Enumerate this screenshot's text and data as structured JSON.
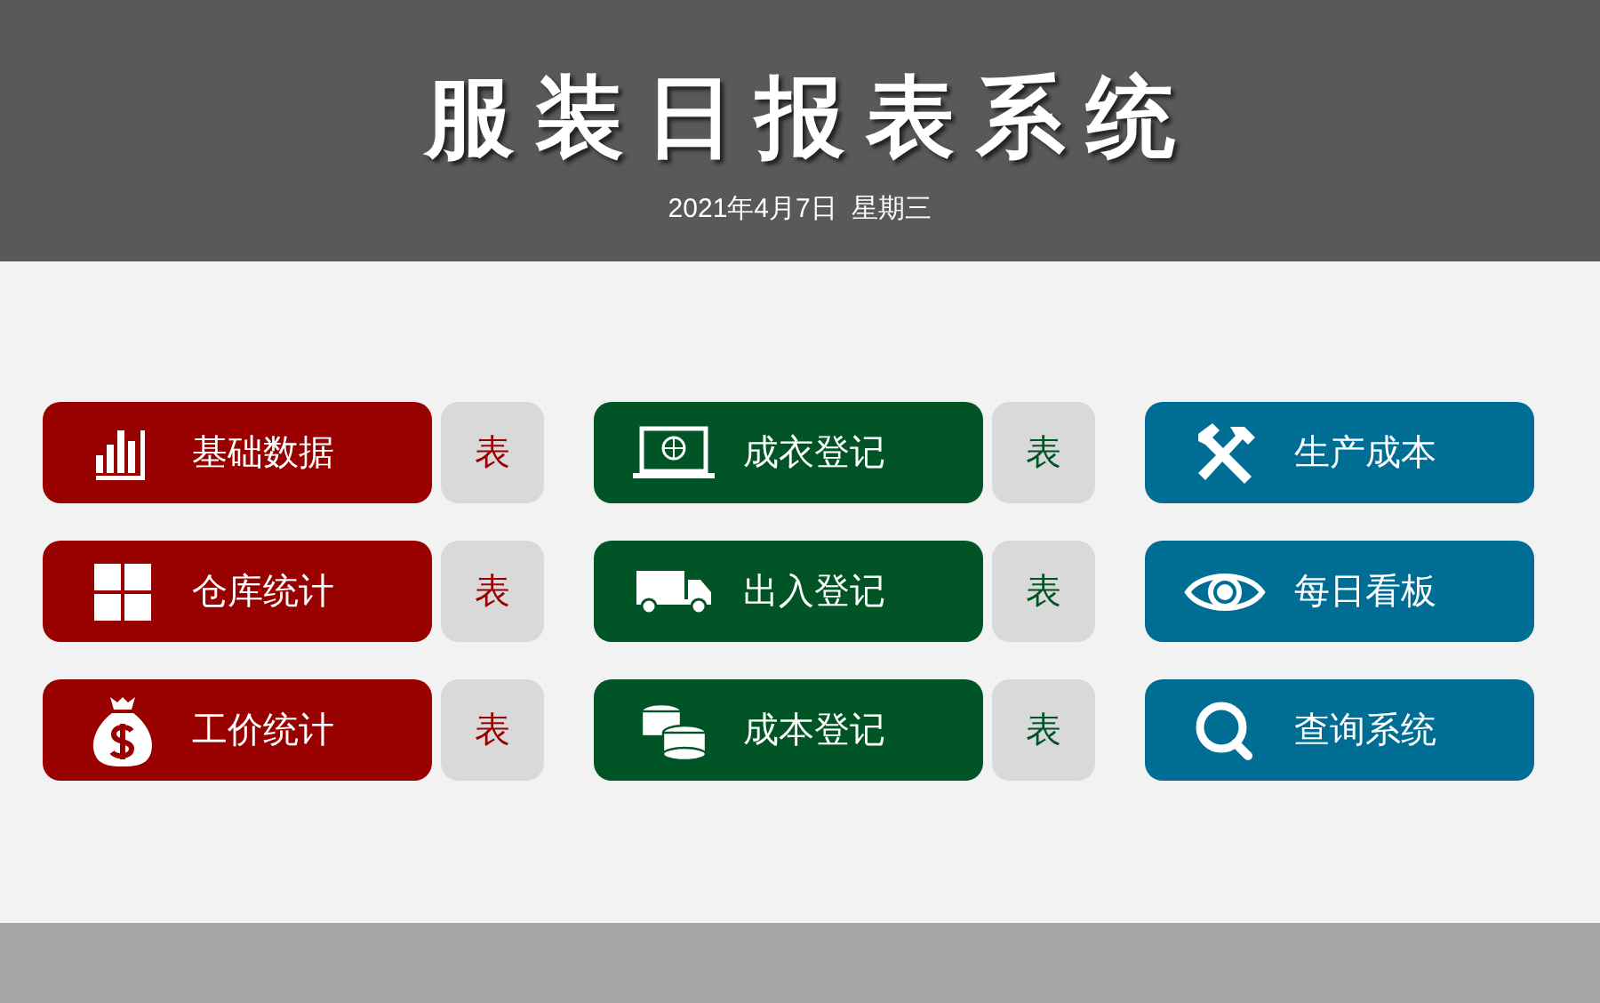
{
  "header": {
    "title": "服装日报表系统",
    "date": "2021年4月7日  星期三"
  },
  "columns": [
    {
      "color": "#990000",
      "items": [
        {
          "label": "基础数据",
          "table": "表"
        },
        {
          "label": "仓库统计",
          "table": "表"
        },
        {
          "label": "工价统计",
          "table": "表"
        }
      ]
    },
    {
      "color": "#005426",
      "items": [
        {
          "label": "成衣登记",
          "table": "表"
        },
        {
          "label": "出入登记",
          "table": "表"
        },
        {
          "label": "成本登记",
          "table": "表"
        }
      ]
    },
    {
      "color": "#006e94",
      "items": [
        {
          "label": "生产成本"
        },
        {
          "label": "每日看板"
        },
        {
          "label": "查询系统"
        }
      ]
    }
  ]
}
